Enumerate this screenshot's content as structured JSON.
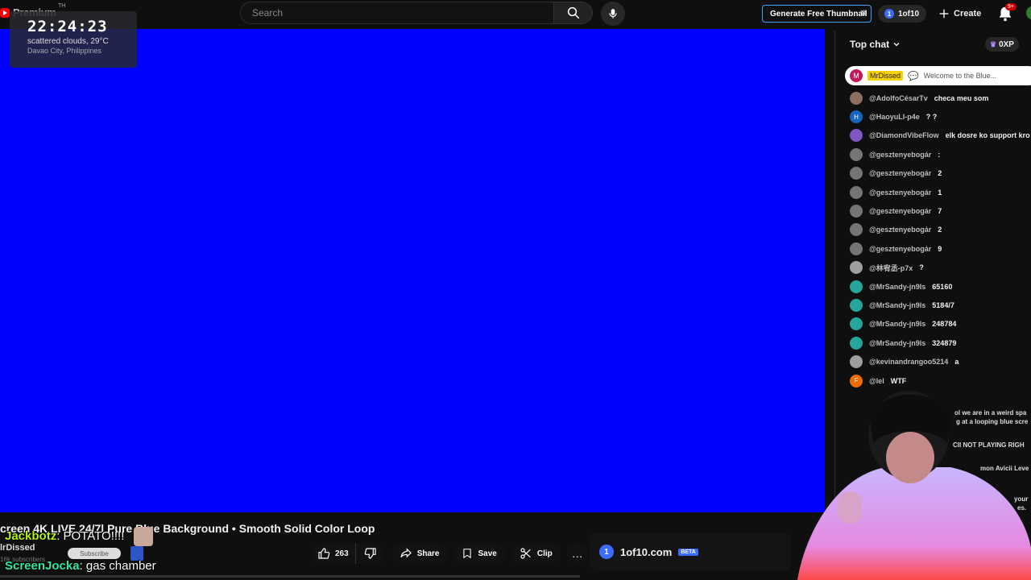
{
  "topbar": {
    "logo_text": "Premium",
    "logo_sup": "TH",
    "search_placeholder": "Search",
    "generate_label": "Generate Free Thumbnail",
    "oneof_label": "1of10",
    "oneof_badge": "1",
    "create_label": "Create",
    "notif_count": "9+"
  },
  "weather": {
    "time": "22:24:23",
    "desc": "scattered clouds, 29°C",
    "location": "Davao City, Philippines"
  },
  "chat": {
    "header": "Top chat",
    "xp": "0XP",
    "pinned": {
      "initial": "M",
      "name": "MrDissed",
      "message": "Welcome to the Blue..."
    },
    "messages": [
      {
        "initial": "",
        "color": "#8d6e63",
        "author": "@AdolfoCésarTv",
        "text": "checa meu som"
      },
      {
        "initial": "H",
        "color": "#1565c0",
        "author": "@HaoyuLI-p4e",
        "text": "? ?"
      },
      {
        "initial": "",
        "color": "#7e57c2",
        "author": "@DiamondVibeFlow",
        "text": "elk dosre ko support kro"
      },
      {
        "initial": "",
        "color": "#757575",
        "author": "@gesztenyebogár",
        "text": ":"
      },
      {
        "initial": "",
        "color": "#757575",
        "author": "@gesztenyebogár",
        "text": "2"
      },
      {
        "initial": "",
        "color": "#757575",
        "author": "@gesztenyebogár",
        "text": "1"
      },
      {
        "initial": "",
        "color": "#757575",
        "author": "@gesztenyebogár",
        "text": "7"
      },
      {
        "initial": "",
        "color": "#757575",
        "author": "@gesztenyebogár",
        "text": "2"
      },
      {
        "initial": "",
        "color": "#757575",
        "author": "@gesztenyebogár",
        "text": "9"
      },
      {
        "initial": "",
        "color": "#9e9e9e",
        "author": "@林宥丞-p7x",
        "text": "?"
      },
      {
        "initial": "",
        "color": "#26a69a",
        "author": "@MrSandy-jn9ls",
        "text": "65160"
      },
      {
        "initial": "",
        "color": "#26a69a",
        "author": "@MrSandy-jn9ls",
        "text": "5184/7"
      },
      {
        "initial": "",
        "color": "#26a69a",
        "author": "@MrSandy-jn9ls",
        "text": "248784"
      },
      {
        "initial": "",
        "color": "#26a69a",
        "author": "@MrSandy-jn9ls",
        "text": "324879"
      },
      {
        "initial": "",
        "color": "#9e9e9e",
        "author": "@kevinandrangoo5214",
        "text": "a"
      },
      {
        "initial": "F",
        "color": "#ef6c00",
        "author": "@lel",
        "text": "WTF"
      }
    ],
    "fragments": [
      "ol we are in a weird spa",
      "g at a looping blue scre",
      "CII NOT PLAYING RIGH",
      "mon Avicii Leve",
      "your",
      "es."
    ]
  },
  "video": {
    "title": "creen 4K LIVE 24/7| Pure Blue Background • Smooth Solid Color Loop",
    "channel": "lrDissed",
    "subscribers": "16k subscribers",
    "subscribe_label": "Subscribe",
    "likes": "263",
    "share_label": "Share",
    "save_label": "Save",
    "clip_label": "Clip",
    "more_label": "…",
    "oneof_site": "1of10.com",
    "oneof_badge": "1",
    "beta_label": "BETA"
  },
  "alerts": [
    {
      "user": "Jackbotz",
      "message": ": POTATO!!!!"
    },
    {
      "user": "ScreenJocka",
      "message": ": gas chamber"
    }
  ],
  "colors": {
    "video_bg": "#0000fe",
    "accent_blue": "#3ea6ff",
    "pinned_name_bg": "#f7d000"
  }
}
